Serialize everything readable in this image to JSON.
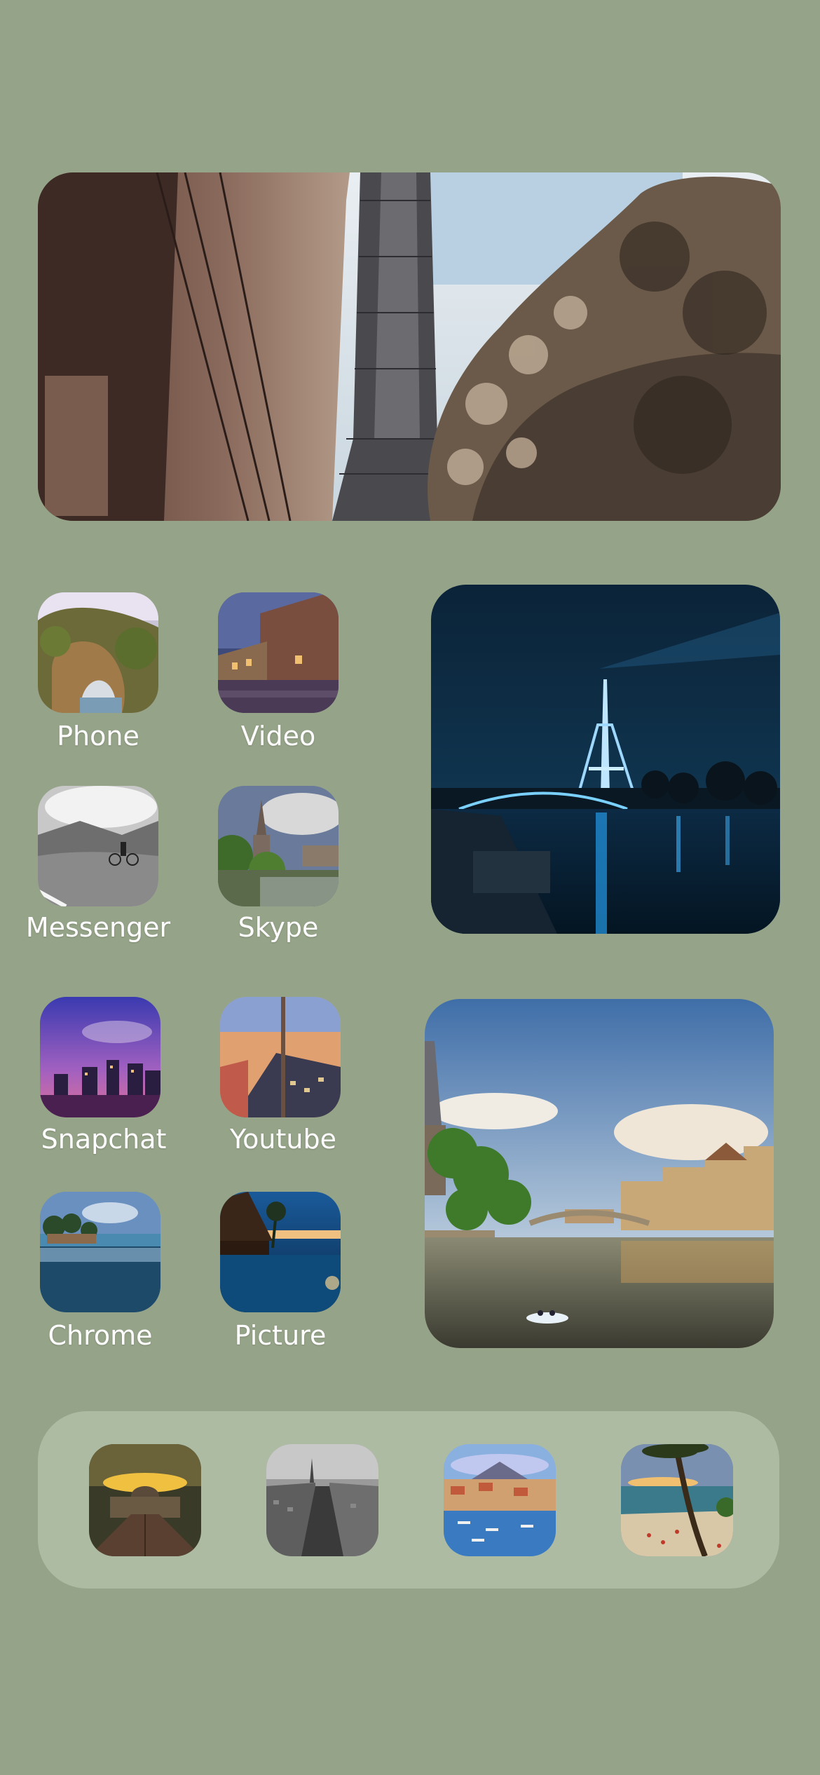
{
  "screen": {
    "background": "#95a388",
    "dock_background": "#acbba2"
  },
  "widgets": [
    {
      "name": "eiffel-tower-street-photo",
      "subject": "Eiffel Tower between Paris building and tree (sepia)"
    },
    {
      "name": "eiffel-tower-night-photo",
      "subject": "Eiffel Tower lit at night over the Seine"
    },
    {
      "name": "river-town-photo",
      "subject": "River town with cathedral and boat at sunset"
    }
  ],
  "apps": {
    "phone": {
      "label": "Phone",
      "icon": "rock-arch-icon"
    },
    "video": {
      "label": "Video",
      "icon": "old-town-canal-icon"
    },
    "messenger": {
      "label": "Messenger",
      "icon": "cyclist-road-icon"
    },
    "skype": {
      "label": "Skype",
      "icon": "church-lake-icon"
    },
    "snapchat": {
      "label": "Snapchat",
      "icon": "city-skyline-dusk-icon"
    },
    "youtube": {
      "label": "Youtube",
      "icon": "paris-rooftops-icon"
    },
    "chrome": {
      "label": "Chrome",
      "icon": "tropical-lagoon-icon"
    },
    "picture": {
      "label": "Picture",
      "icon": "overwater-bungalow-icon"
    }
  },
  "dock": [
    {
      "name": "dock-app-1",
      "icon": "institute-square-sunset-icon"
    },
    {
      "name": "dock-app-2",
      "icon": "paris-avenue-bw-icon"
    },
    {
      "name": "dock-app-3",
      "icon": "harbor-city-icon"
    },
    {
      "name": "dock-app-4",
      "icon": "beach-palm-icon"
    }
  ]
}
